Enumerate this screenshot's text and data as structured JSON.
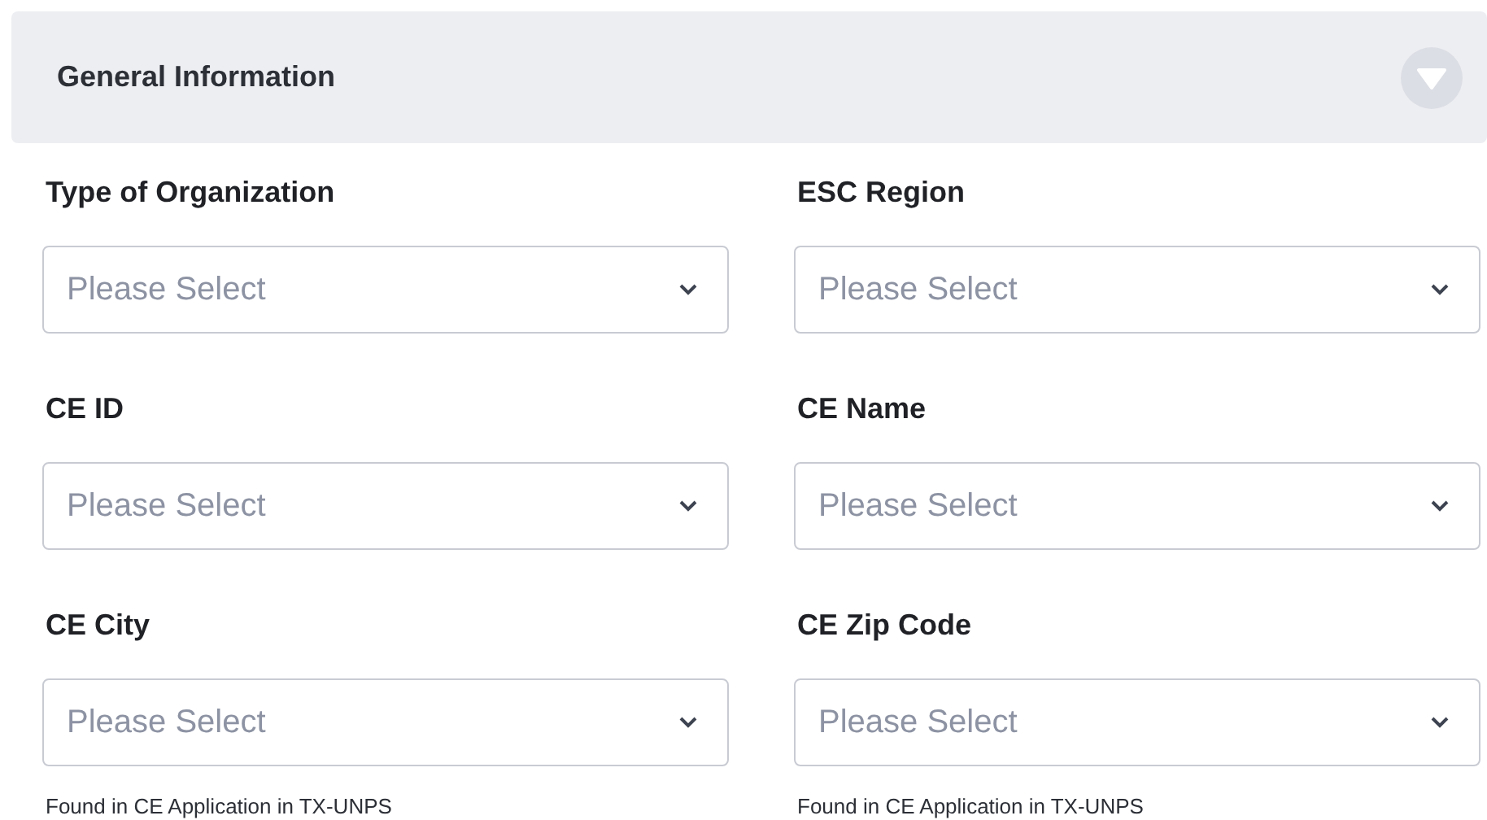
{
  "section": {
    "title": "General Information"
  },
  "fields": [
    {
      "label": "Type of Organization",
      "placeholder": "Please Select"
    },
    {
      "label": "ESC Region",
      "placeholder": "Please Select"
    },
    {
      "label": "CE ID",
      "placeholder": "Please Select"
    },
    {
      "label": "CE Name",
      "placeholder": "Please Select"
    },
    {
      "label": "CE City",
      "placeholder": "Please Select",
      "hint": "Found in CE Application in TX-UNPS"
    },
    {
      "label": "CE Zip Code",
      "placeholder": "Please Select",
      "hint": "Found in CE Application in TX-UNPS"
    }
  ]
}
